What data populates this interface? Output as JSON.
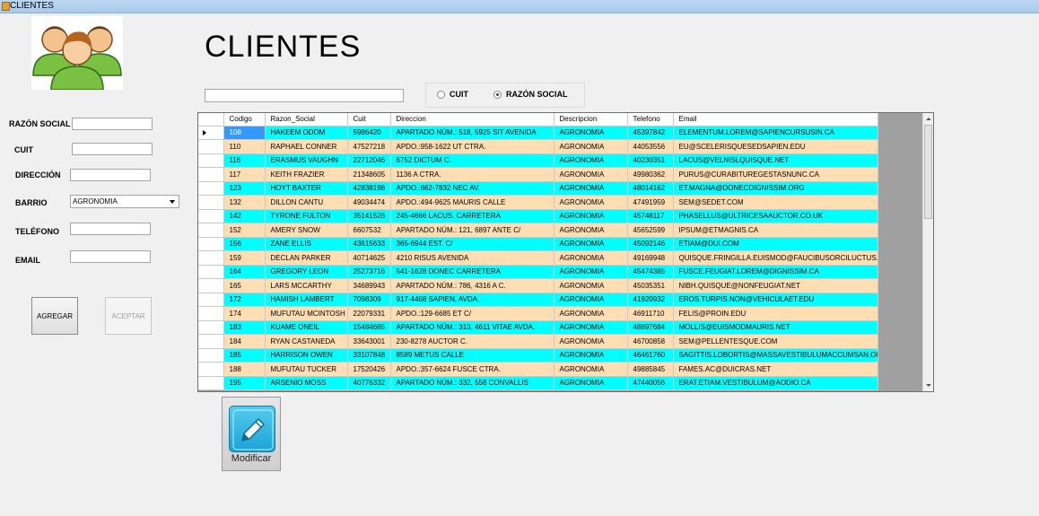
{
  "window": {
    "title": "CLIENTES"
  },
  "page": {
    "title": "CLIENTES"
  },
  "search": {
    "value": ""
  },
  "search_mode": {
    "options": [
      "CUIT",
      "RAZÓN SOCIAL"
    ],
    "selected": "RAZÓN SOCIAL"
  },
  "form": {
    "razon_social_label": "RAZÓN SOCIAL",
    "cuit_label": "CUIT",
    "direccion_label": "DIRECCIÓN",
    "barrio_label": "BARRIO",
    "barrio_value": "AGRONOMIA",
    "telefono_label": "TELÉFONO",
    "email_label": "EMAIL",
    "agregar_label": "AGREGAR",
    "aceptar_label": "ACEPTAR"
  },
  "grid": {
    "columns": [
      "Codigo",
      "Razon_Social",
      "Cuit",
      "Direccion",
      "Descripcion",
      "Telefono",
      "Email"
    ],
    "rows": [
      [
        "108",
        "HAKEEM ODOM",
        "5986420",
        "APARTADO NÚM.: 518, 5925 SIT AVENIDA",
        "AGRONOMIA",
        "45397842",
        "ELEMENTUM.LOREM@SAPIENCURSUSIN.CA"
      ],
      [
        "110",
        "RAPHAEL CONNER",
        "47527218",
        "APDO.:958-1622 UT CTRA.",
        "AGRONOMIA",
        "44053556",
        "EU@SCELERISQUESEDSAPIEN.EDU"
      ],
      [
        "116",
        "ERASMUS VAUGHN",
        "22712046",
        "6752 DICTUM C.",
        "AGRONOMIA",
        "40230351",
        "LACUS@VELNISLQUISQUE.NET"
      ],
      [
        "117",
        "KEITH FRAZIER",
        "21348605",
        "1136 A CTRA.",
        "AGRONOMIA",
        "49980362",
        "PURUS@CURABITUREGESTASNUNC.CA"
      ],
      [
        "123",
        "HOYT BAXTER",
        "42838198",
        "APDO.:862-7832 NEC AV.",
        "AGRONOMIA",
        "48014162",
        "ET.MAGNA@DONECDIGNISSIM.ORG"
      ],
      [
        "132",
        "DILLON CANTU",
        "49034474",
        "APDO.:494-9625 MAURIS CALLE",
        "AGRONOMIA",
        "47491959",
        "SEM@SEDET.COM"
      ],
      [
        "142",
        "TYRONE FULTON",
        "35141526",
        "245-4666 LACUS. CARRETERA",
        "AGRONOMIA",
        "45748117",
        "PHASELLUS@ULTRICESAAUCTOR.CO.UK"
      ],
      [
        "152",
        "AMERY SNOW",
        "6607532",
        "APARTADO NÚM.: 121, 6897 ANTE C/",
        "AGRONOMIA",
        "45652599",
        "IPSUM@ETMAGNIS.CA"
      ],
      [
        "156",
        "ZANE ELLIS",
        "43615633",
        "365-6944 EST. C/",
        "AGRONOMIA",
        "45092146",
        "ETIAM@DUI.COM"
      ],
      [
        "159",
        "DECLAN PARKER",
        "40714625",
        "4210 RISUS AVENIDA",
        "AGRONOMIA",
        "49169948",
        "QUISQUE.FRINGILLA.EUISMOD@FAUCIBUSORCILUCTUS.NET"
      ],
      [
        "164",
        "GREGORY LEON",
        "25273716",
        "541-1628 DONEC CARRETERA",
        "AGRONOMIA",
        "45474385",
        "FUSCE.FEUGIAT.LOREM@DIGNISSIM.CA"
      ],
      [
        "165",
        "LARS MCCARTHY",
        "34689943",
        "APARTADO NÚM.: 786, 4316 A C.",
        "AGRONOMIA",
        "45035351",
        "NIBH.QUISQUE@NONFEUGIAT.NET"
      ],
      [
        "172",
        "HAMISH LAMBERT",
        "7098309",
        "917-4468 SAPIEN, AVDA.",
        "AGRONOMIA",
        "41920932",
        "EROS.TURPIS.NON@VEHICULAET.EDU"
      ],
      [
        "174",
        "MUFUTAU MCINTOSH",
        "22079331",
        "APDO.:129-6685 ET C/",
        "AGRONOMIA",
        "46911710",
        "FELIS@PROIN.EDU"
      ],
      [
        "183",
        "KUAME ONEIL",
        "15484685",
        "APARTADO NÚM.: 313, 4611 VITAE AVDA.",
        "AGRONOMIA",
        "48897684",
        "MOLLIS@EUISMODMAURIS.NET"
      ],
      [
        "184",
        "RYAN CASTANEDA",
        "33643001",
        "230-8278 AUCTOR C.",
        "AGRONOMIA",
        "46700858",
        "SEM@PELLENTESQUE.COM"
      ],
      [
        "185",
        "HARRISON OWEN",
        "33107848",
        "8589 METUS CALLE",
        "AGRONOMIA",
        "46461760",
        "SAGITTIS.LOBORTIS@MASSAVESTIBULUMACCUMSAN.ORG"
      ],
      [
        "188",
        "MUFUTAU TUCKER",
        "17520426",
        "APDO.:357-6624 FUSCE CTRA.",
        "AGRONOMIA",
        "49885845",
        "FAMES.AC@DUICRAS.NET"
      ],
      [
        "195",
        "ARSENIO MOSS",
        "40776332",
        "APARTADO NÚM.: 332, 558 CONVALLIS",
        "AGRONOMIA",
        "47440056",
        "ERAT.ETIAM.VESTIBULUM@AODIO.CA"
      ]
    ]
  },
  "modify": {
    "label": "Modificar"
  },
  "icons": {
    "app": "app-icon",
    "avatar": "users-group-icon",
    "edit": "pencil-edit-icon"
  },
  "colors": {
    "row_odd": "#00ffff",
    "row_even": "#ffdeb3",
    "selection": "#3399ff"
  }
}
